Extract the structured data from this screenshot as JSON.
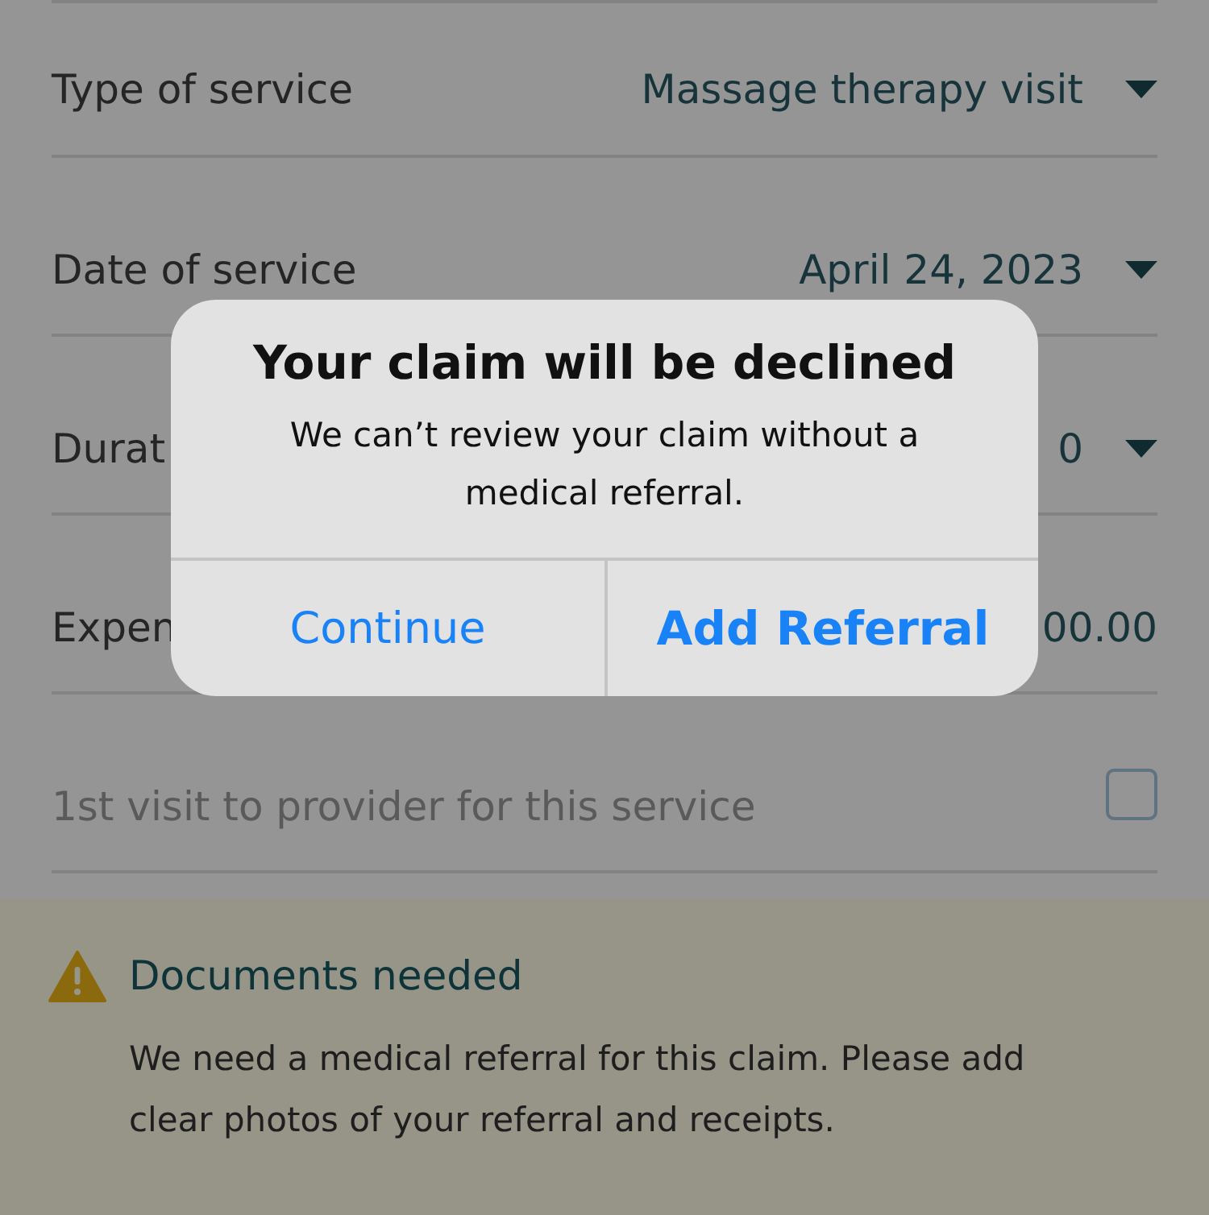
{
  "form_rows": [
    {
      "kind": "select",
      "label": "Type of service",
      "value": "Massage therapy visit"
    },
    {
      "kind": "select",
      "label": "Date of service",
      "value": "April 24, 2023"
    },
    {
      "kind": "select",
      "label": "Durat",
      "value": "0"
    },
    {
      "kind": "amount",
      "label": "Expen",
      "value": "00.00"
    },
    {
      "kind": "checkbox",
      "label": "1st visit to provider for this service",
      "checked": false
    }
  ],
  "notice": {
    "title": "Documents needed",
    "body": "We need a medical referral for this claim. Please add clear photos of your referral and receipts."
  },
  "dialog": {
    "title": "Your claim will be declined",
    "message": "We can’t review your claim without a medical referral.",
    "buttons": [
      {
        "label": "Continue",
        "primary": false
      },
      {
        "label": "Add Referral",
        "primary": true
      }
    ]
  }
}
